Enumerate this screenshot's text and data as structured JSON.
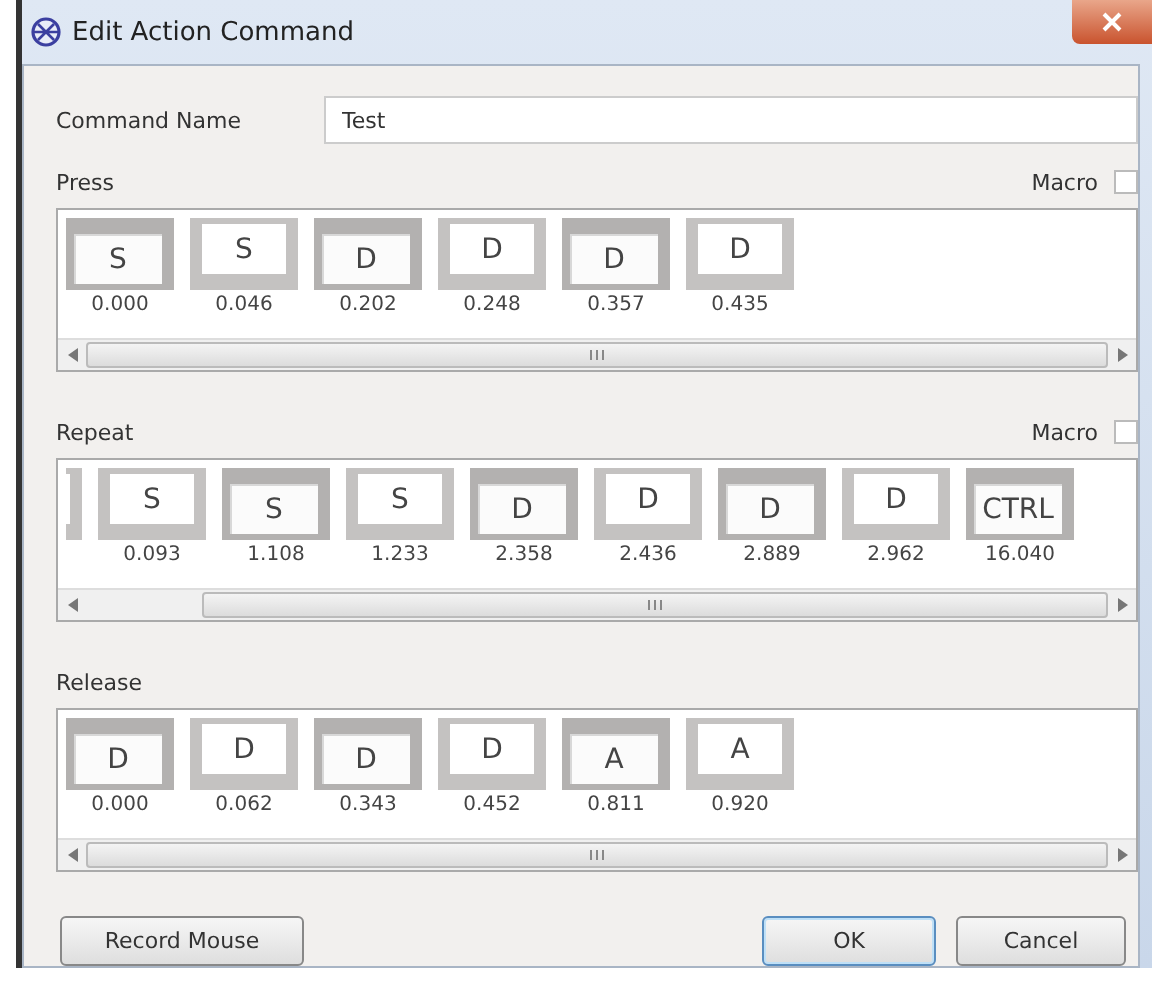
{
  "window": {
    "title": "Edit Action Command"
  },
  "command_name": {
    "label": "Command Name",
    "value": "Test"
  },
  "sections": [
    {
      "title": "Press",
      "macro": {
        "label": "Macro",
        "checked": false
      },
      "keys": [
        {
          "kind": "key",
          "label": "S",
          "time": "0.000",
          "pressed": true
        },
        {
          "kind": "key",
          "label": "S",
          "time": "0.046",
          "pressed": false
        },
        {
          "kind": "key",
          "label": "D",
          "time": "0.202",
          "pressed": true
        },
        {
          "kind": "key",
          "label": "D",
          "time": "0.248",
          "pressed": false
        },
        {
          "kind": "key",
          "label": "D",
          "time": "0.357",
          "pressed": true
        },
        {
          "kind": "key",
          "label": "D",
          "time": "0.435",
          "pressed": false
        }
      ]
    },
    {
      "title": "Repeat",
      "macro": {
        "label": "Macro",
        "checked": false
      },
      "keys": [
        {
          "kind": "clipped",
          "pressed": false
        },
        {
          "kind": "key",
          "label": "S",
          "time": "0.093",
          "pressed": false
        },
        {
          "kind": "key",
          "label": "S",
          "time": "1.108",
          "pressed": true
        },
        {
          "kind": "key",
          "label": "S",
          "time": "1.233",
          "pressed": false
        },
        {
          "kind": "key",
          "label": "D",
          "time": "2.358",
          "pressed": true
        },
        {
          "kind": "key",
          "label": "D",
          "time": "2.436",
          "pressed": false
        },
        {
          "kind": "key",
          "label": "D",
          "time": "2.889",
          "pressed": true
        },
        {
          "kind": "key",
          "label": "D",
          "time": "2.962",
          "pressed": false
        },
        {
          "kind": "key",
          "label": "CTRL",
          "time": "16.040",
          "pressed": true
        }
      ]
    },
    {
      "title": "Release",
      "keys": [
        {
          "kind": "key",
          "label": "D",
          "time": "0.000",
          "pressed": true
        },
        {
          "kind": "key",
          "label": "D",
          "time": "0.062",
          "pressed": false
        },
        {
          "kind": "key",
          "label": "D",
          "time": "0.343",
          "pressed": true
        },
        {
          "kind": "key",
          "label": "D",
          "time": "0.452",
          "pressed": false
        },
        {
          "kind": "key",
          "label": "A",
          "time": "0.811",
          "pressed": true
        },
        {
          "kind": "key",
          "label": "A",
          "time": "0.920",
          "pressed": false
        }
      ]
    }
  ],
  "buttons": {
    "record": "Record Mouse",
    "ok": "OK",
    "cancel": "Cancel"
  }
}
